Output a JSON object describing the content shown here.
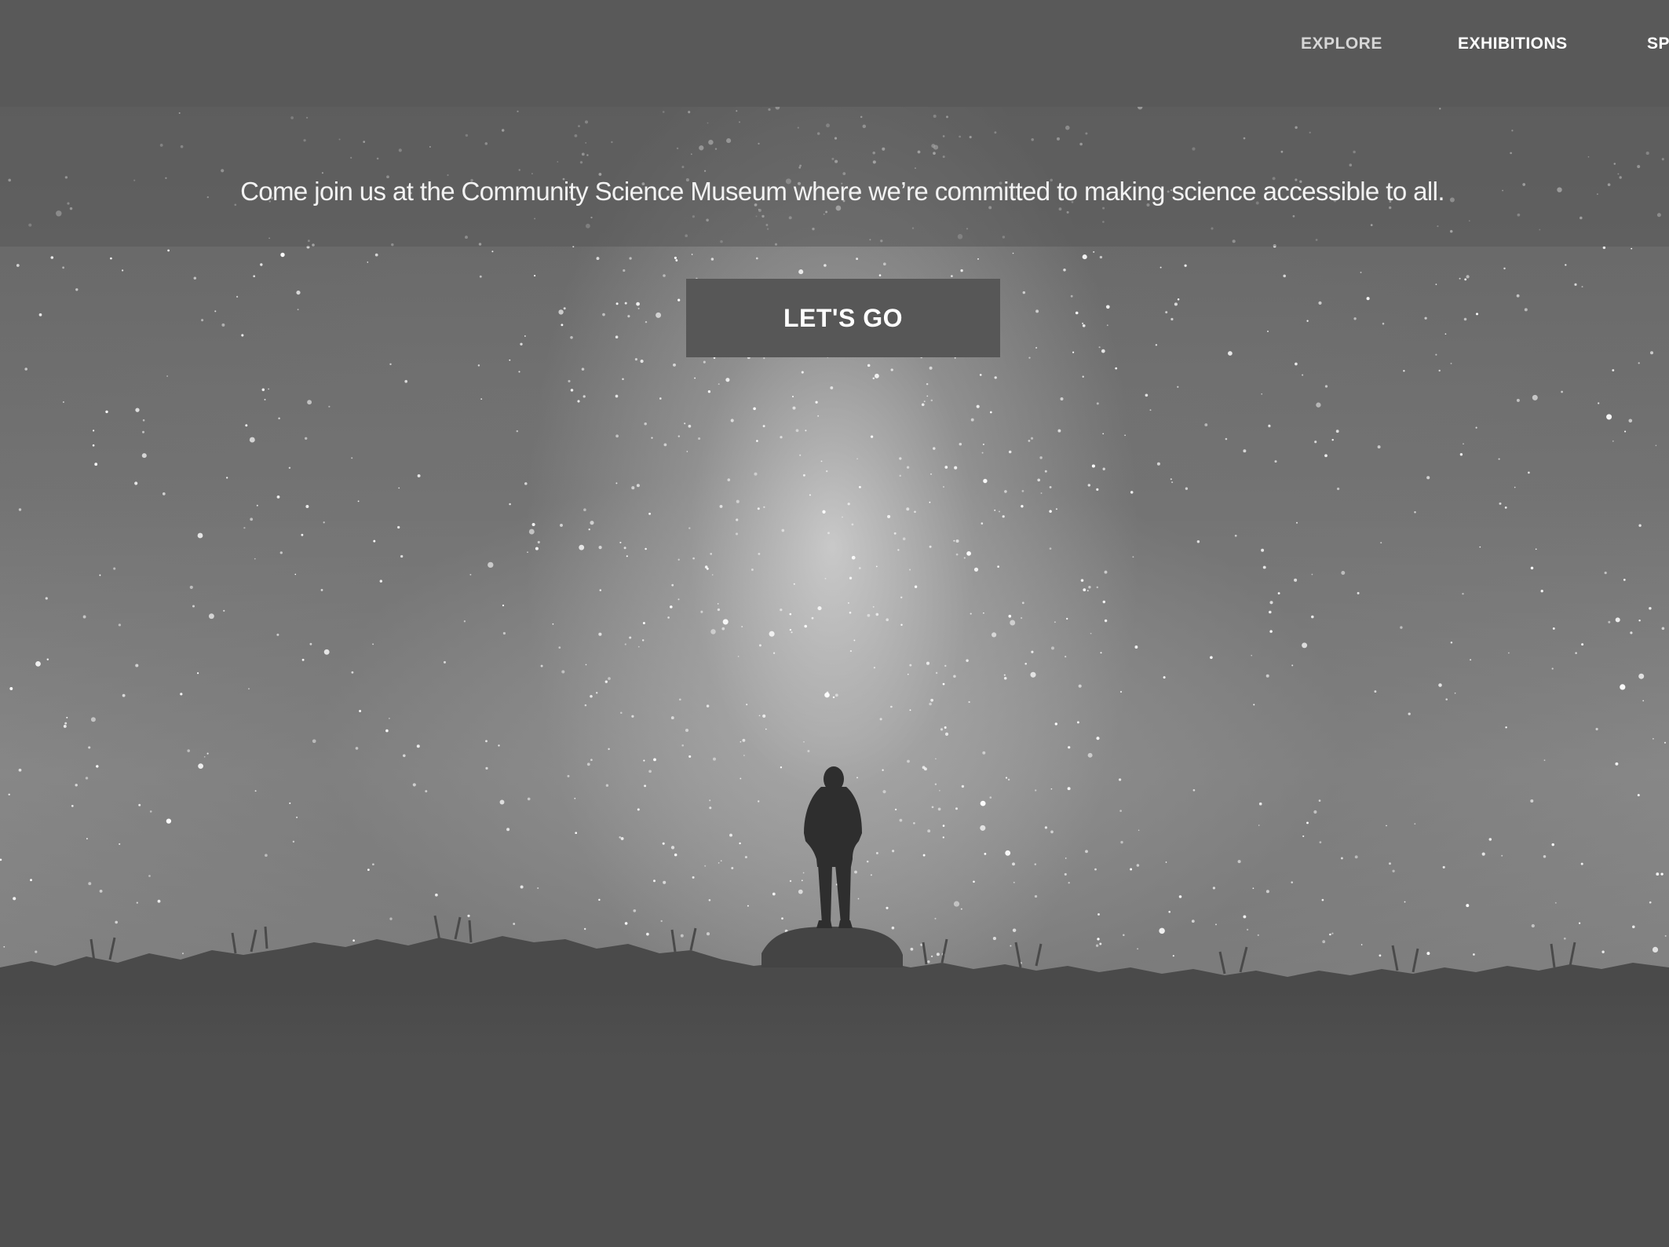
{
  "nav": {
    "items": [
      {
        "label": "EXPLORE"
      },
      {
        "label": "EXHIBITIONS"
      },
      {
        "label": "SP"
      }
    ]
  },
  "hero": {
    "intro": "Come join us at the Community Science Museum where we’re committed to making science accessible to all.",
    "cta_label": "LET'S GO",
    "image": "night-sky-silhouette"
  },
  "colors": {
    "header_bg": "#595959",
    "button_bg": "#575757",
    "page_bg": "#4f4f4f",
    "nav_text": "#ffffff",
    "nav_text_muted": "#d6d6d6"
  }
}
